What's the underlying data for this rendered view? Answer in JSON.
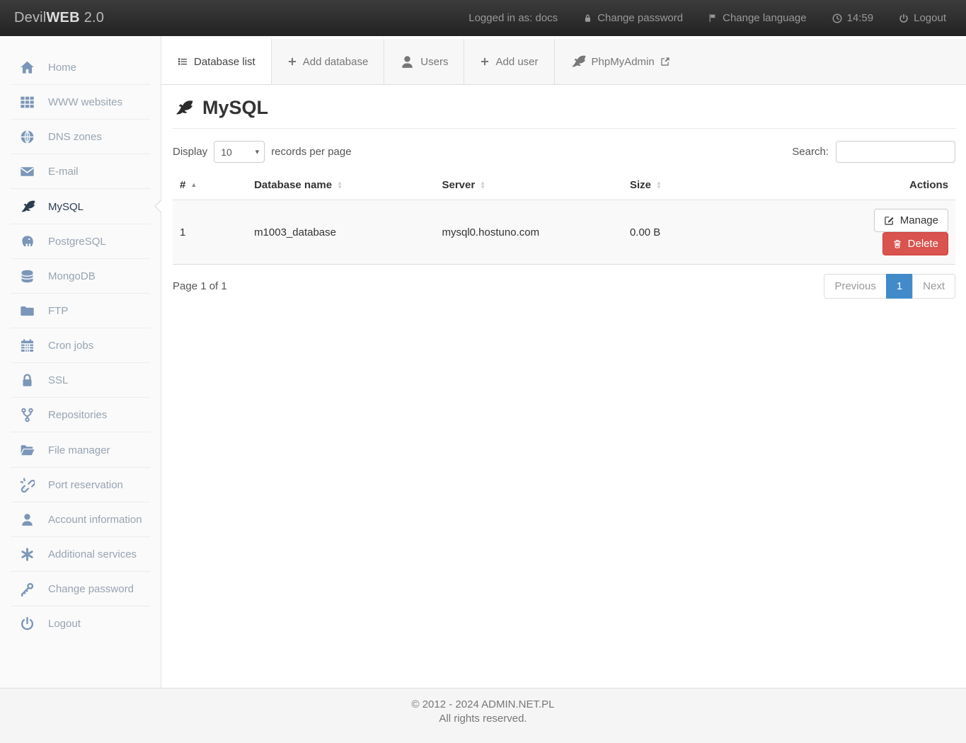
{
  "colors": {
    "accent": "#428bca",
    "danger": "#d9534f",
    "sidebar_icon": "#7b96b8",
    "active_item": "#2c3e50"
  },
  "navbar": {
    "brand": {
      "prefix": "Devil",
      "bold": "WEB",
      "version": "2.0"
    },
    "logged_in": "Logged in as: docs",
    "change_password": "Change password",
    "change_language": "Change language",
    "time": "14:59",
    "logout": "Logout"
  },
  "sidebar": {
    "items": [
      {
        "label": "Home",
        "icon": "home",
        "active": false
      },
      {
        "label": "WWW websites",
        "icon": "grid",
        "active": false
      },
      {
        "label": "DNS zones",
        "icon": "globe",
        "active": false
      },
      {
        "label": "E-mail",
        "icon": "envelope",
        "active": false
      },
      {
        "label": "MySQL",
        "icon": "mysql-bird",
        "active": true
      },
      {
        "label": "PostgreSQL",
        "icon": "postgresql-elephant",
        "active": false
      },
      {
        "label": "MongoDB",
        "icon": "database-cylinder",
        "active": false
      },
      {
        "label": "FTP",
        "icon": "folder",
        "active": false
      },
      {
        "label": "Cron jobs",
        "icon": "calendar",
        "active": false
      },
      {
        "label": "SSL",
        "icon": "lock",
        "active": false
      },
      {
        "label": "Repositories",
        "icon": "code-fork",
        "active": false
      },
      {
        "label": "File manager",
        "icon": "folder-open",
        "active": false
      },
      {
        "label": "Port reservation",
        "icon": "chain-broken",
        "active": false
      },
      {
        "label": "Account information",
        "icon": "user",
        "active": false
      },
      {
        "label": "Additional services",
        "icon": "asterisk",
        "active": false
      },
      {
        "label": "Change password",
        "icon": "key",
        "active": false
      },
      {
        "label": "Logout",
        "icon": "power",
        "active": false
      }
    ]
  },
  "tabs": [
    {
      "label": "Database list",
      "icon": "list",
      "active": true,
      "external": false
    },
    {
      "label": "Add database",
      "icon": "plus",
      "active": false,
      "external": false
    },
    {
      "label": "Users",
      "icon": "user",
      "active": false,
      "external": false
    },
    {
      "label": "Add user",
      "icon": "plus",
      "active": false,
      "external": false
    },
    {
      "label": "PhpMyAdmin",
      "icon": "mysql-bird",
      "active": false,
      "external": true
    }
  ],
  "page": {
    "title": "MySQL"
  },
  "table": {
    "display_label": "Display",
    "page_size": "10",
    "records_label": "records per page",
    "search_label": "Search:",
    "search_value": "",
    "columns": [
      {
        "label": "#",
        "sort": "asc"
      },
      {
        "label": "Database name",
        "sort": "both"
      },
      {
        "label": "Server",
        "sort": "both"
      },
      {
        "label": "Size",
        "sort": "both"
      },
      {
        "label": "Actions",
        "sort": "none"
      }
    ],
    "rows": [
      {
        "num": "1",
        "name": "m1003_database",
        "server": "mysql0.hostuno.com",
        "size": "0.00 B"
      }
    ],
    "actions": {
      "manage": "Manage",
      "delete": "Delete"
    },
    "page_info": "Page 1 of 1",
    "pagination": {
      "previous": "Previous",
      "current": "1",
      "next": "Next"
    }
  },
  "footer": {
    "line1": "© 2012 - 2024 ADMIN.NET.PL",
    "line2": "All rights reserved."
  }
}
